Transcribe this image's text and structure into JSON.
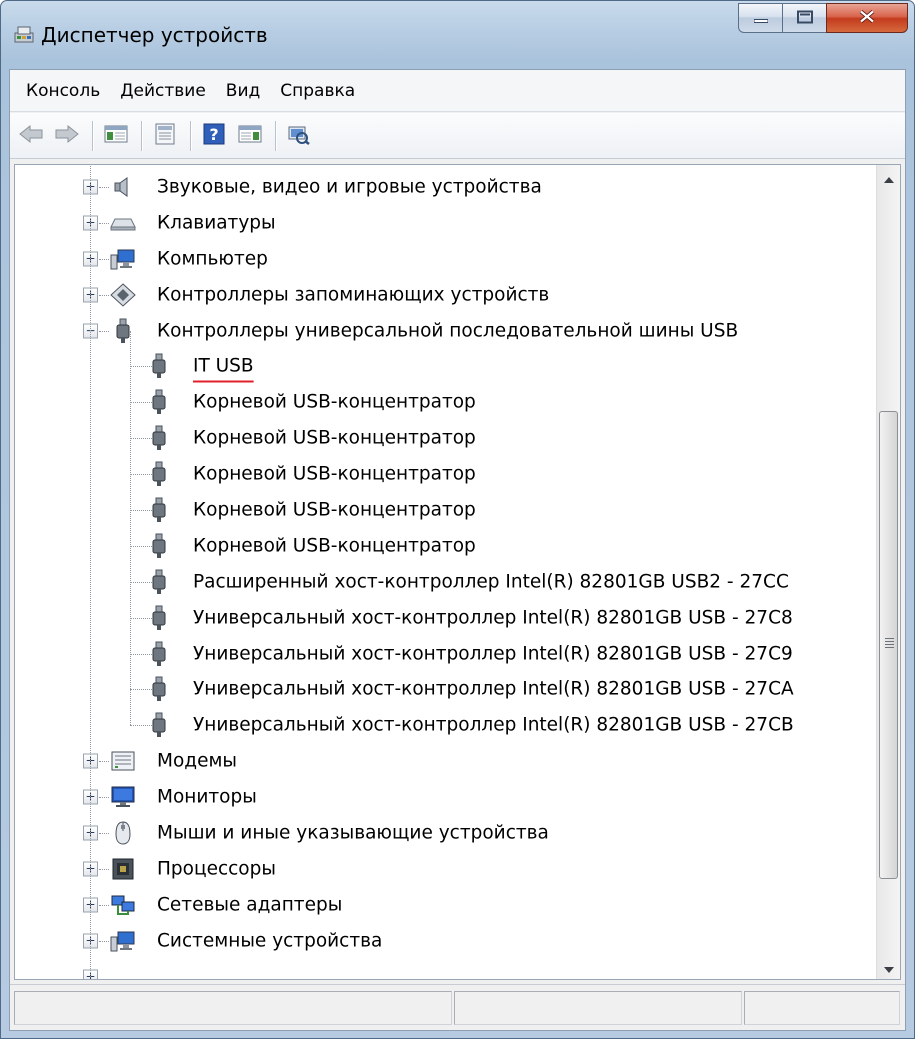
{
  "window": {
    "title": "Диспетчер устройств"
  },
  "menu": [
    {
      "label": "Консоль"
    },
    {
      "label": "Действие"
    },
    {
      "label": "Вид"
    },
    {
      "label": "Справка"
    }
  ],
  "toolbar": {
    "icons": [
      "back-arrow-icon",
      "forward-arrow-icon",
      "console-tree-icon",
      "properties-icon",
      "help-icon",
      "action-pane-icon",
      "scan-hardware-icon"
    ]
  },
  "tree": [
    {
      "label": "Звуковые, видео и игровые устройства",
      "level": 1,
      "expanded": false,
      "icon": "speaker-icon"
    },
    {
      "label": "Клавиатуры",
      "level": 1,
      "expanded": false,
      "icon": "keyboard-icon"
    },
    {
      "label": "Компьютер",
      "level": 1,
      "expanded": false,
      "icon": "computer-icon"
    },
    {
      "label": "Контроллеры запоминающих устройств",
      "level": 1,
      "expanded": false,
      "icon": "storage-controller-icon"
    },
    {
      "label": "Контроллеры универсальной последовательной шины USB",
      "level": 1,
      "expanded": true,
      "icon": "usb-plug-icon"
    },
    {
      "label": "IT USB",
      "level": 2,
      "icon": "usb-plug-icon",
      "highlighted": true
    },
    {
      "label": "Корневой USB-концентратор",
      "level": 2,
      "icon": "usb-plug-icon"
    },
    {
      "label": "Корневой USB-концентратор",
      "level": 2,
      "icon": "usb-plug-icon"
    },
    {
      "label": "Корневой USB-концентратор",
      "level": 2,
      "icon": "usb-plug-icon"
    },
    {
      "label": "Корневой USB-концентратор",
      "level": 2,
      "icon": "usb-plug-icon"
    },
    {
      "label": "Корневой USB-концентратор",
      "level": 2,
      "icon": "usb-plug-icon"
    },
    {
      "label": "Расширенный хост-контроллер Intel(R) 82801GB USB2 - 27CC",
      "level": 2,
      "icon": "usb-plug-icon"
    },
    {
      "label": "Универсальный хост-контроллер Intel(R) 82801GB USB - 27C8",
      "level": 2,
      "icon": "usb-plug-icon"
    },
    {
      "label": "Универсальный хост-контроллер Intel(R) 82801GB USB - 27C9",
      "level": 2,
      "icon": "usb-plug-icon"
    },
    {
      "label": "Универсальный хост-контроллер Intel(R) 82801GB USB - 27CA",
      "level": 2,
      "icon": "usb-plug-icon"
    },
    {
      "label": "Универсальный хост-контроллер Intel(R) 82801GB USB - 27CB",
      "level": 2,
      "icon": "usb-plug-icon"
    },
    {
      "label": "Модемы",
      "level": 1,
      "expanded": false,
      "icon": "modem-icon"
    },
    {
      "label": "Мониторы",
      "level": 1,
      "expanded": false,
      "icon": "monitor-icon"
    },
    {
      "label": "Мыши и иные указывающие устройства",
      "level": 1,
      "expanded": false,
      "icon": "mouse-icon"
    },
    {
      "label": "Процессоры",
      "level": 1,
      "expanded": false,
      "icon": "processor-icon"
    },
    {
      "label": "Сетевые адаптеры",
      "level": 1,
      "expanded": false,
      "icon": "network-adapter-icon"
    },
    {
      "label": "Системные устройства",
      "level": 1,
      "expanded": false,
      "icon": "system-devices-icon"
    }
  ],
  "colors": {
    "underline": "#e0202a",
    "close_button": "#c33b1d"
  }
}
